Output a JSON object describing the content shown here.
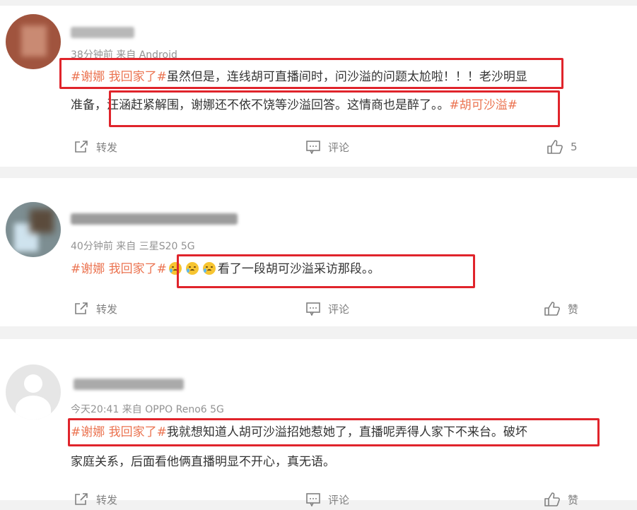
{
  "posts": [
    {
      "meta": "38分钟前  来自 Android",
      "line1": {
        "tag": "#谢娜 我回家了#",
        "text": "虽然但是，连线胡可直播间时，问沙溢的问题太尬啦！！！老沙明显"
      },
      "line2": {
        "text": "准备，汪涵赶紧解围，谢娜还不依不饶等沙溢回答。这情商也是醉了。。",
        "tag": "#胡可沙溢#"
      },
      "actions": {
        "repost": "转发",
        "comment": "评论",
        "like": "5"
      }
    },
    {
      "meta": "40分钟前  来自 三星S20 5G",
      "line1": {
        "tag": "#谢娜 我回家了#",
        "text": "看了一段胡可沙溢采访那段。。"
      },
      "actions": {
        "repost": "转发",
        "comment": "评论",
        "like": "赞"
      }
    },
    {
      "meta": "今天20:41  来自 OPPO Reno6 5G",
      "line1": {
        "tag": "#谢娜 我回家了#",
        "text": "我就想知道人胡可沙溢招她惹她了，直播呢弄得人家下不来台。破坏"
      },
      "line2": {
        "text": "家庭关系，后面看他俩直播明显不开心，真无语。"
      },
      "actions": {
        "repost": "转发",
        "comment": "评论",
        "like": "赞"
      }
    }
  ],
  "colors": {
    "highlight": "#e0242b",
    "topic": "#eb7350",
    "meta": "#939393",
    "action": "#808080"
  }
}
